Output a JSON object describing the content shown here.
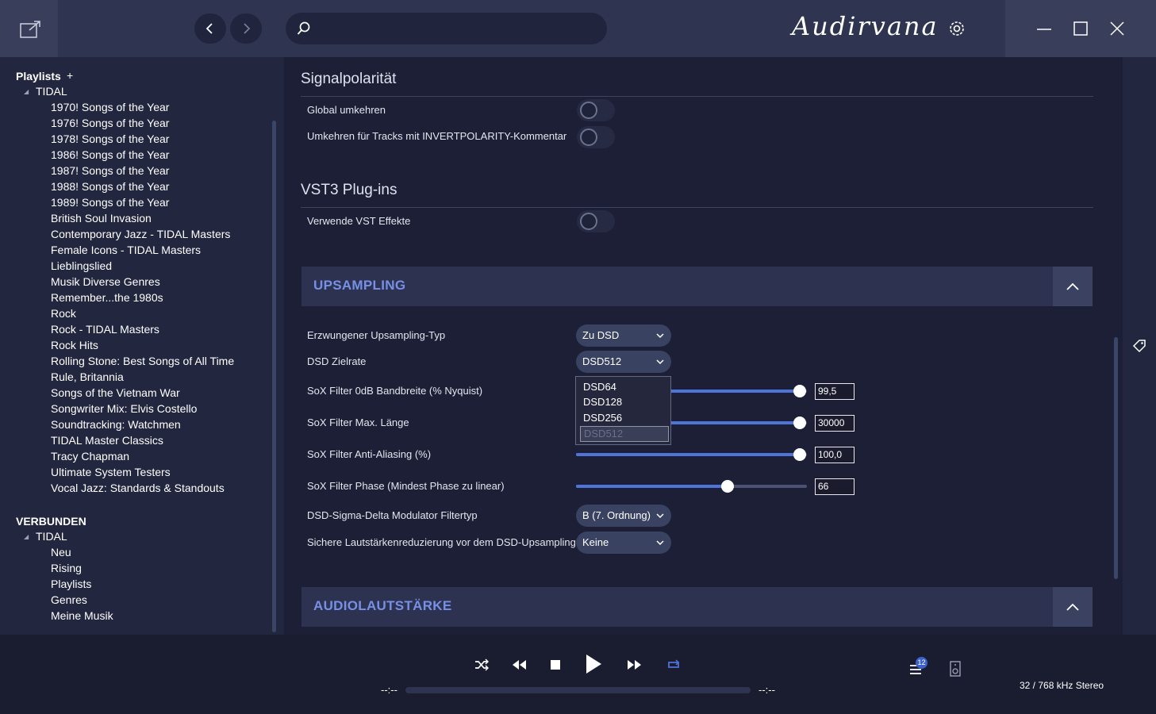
{
  "header": {
    "logo": "Audirvana",
    "search": {
      "placeholder": ""
    }
  },
  "sidebar": {
    "playlists_heading": "Playlists",
    "add_label": "+",
    "tidal_label": "TIDAL",
    "playlists": [
      "1970! Songs of the Year",
      "1976! Songs of the Year",
      "1978! Songs of the Year",
      "1986! Songs of the Year",
      "1987! Songs of the Year",
      "1988! Songs of the Year",
      "1989! Songs of the Year",
      "British Soul Invasion",
      "Contemporary Jazz - TIDAL Masters",
      "Female Icons - TIDAL Masters",
      "Lieblingslied",
      "Musik Diverse Genres",
      "Remember...the 1980s",
      "Rock",
      "Rock - TIDAL Masters",
      "Rock Hits",
      "Rolling Stone: Best Songs of All Time",
      "Rule, Britannia",
      "Songs of the Vietnam War",
      "Songwriter Mix: Elvis Costello",
      "Soundtracking: Watchmen",
      "TIDAL Master Classics",
      "Tracy Chapman",
      "Ultimate System Testers",
      "Vocal Jazz: Standards & Standouts"
    ],
    "connected_heading": "VERBUNDEN",
    "connected_tidal_label": "TIDAL",
    "connected_items": [
      "Neu",
      "Rising",
      "Playlists",
      "Genres",
      "Meine Musik"
    ]
  },
  "signal": {
    "title": "Signalpolarität",
    "global_invert": {
      "label": "Global umkehren",
      "on": false
    },
    "invert_tracks": {
      "label": "Umkehren für Tracks mit INVERTPOLARITY-Kommentar",
      "on": false
    }
  },
  "vst": {
    "title": "VST3 Plug-ins",
    "use_vst": {
      "label": "Verwende VST Effekte",
      "on": false
    }
  },
  "upsampling": {
    "title": "UPSAMPLING",
    "type": {
      "label": "Erzwungener Upsampling-Typ",
      "value": "Zu DSD"
    },
    "dsd_rate": {
      "label": "DSD Zielrate",
      "value": "DSD512",
      "options": [
        "DSD64",
        "DSD128",
        "DSD256"
      ],
      "selected_option": "DSD512"
    },
    "bandwidth": {
      "label": "SoX Filter 0dB Bandbreite (% Nyquist)",
      "value": "99,5",
      "fraction": 0.97
    },
    "max_length": {
      "label": "SoX Filter Max. Länge",
      "value": "30000",
      "fraction": 0.97
    },
    "anti_alias": {
      "label": "SoX Filter Anti-Aliasing (%)",
      "value": "100,0",
      "fraction": 0.97
    },
    "phase": {
      "label": "SoX Filter Phase (Mindest Phase zu linear)",
      "value": "66",
      "fraction": 0.655
    },
    "modulator": {
      "label": "DSD-Sigma-Delta Modulator Filtertyp",
      "value": "B (7. Ordnung)"
    },
    "volume_reduction": {
      "label": "Sichere Lautstärkenreduzierung vor dem DSD-Upsampling",
      "value": "Keine"
    }
  },
  "volume_section": {
    "title": "AUDIOLAUTSTÄRKE"
  },
  "player": {
    "elapsed": "--:--",
    "remaining": "--:--",
    "queue_count": "12",
    "format": "32 / 768 kHz Stereo",
    "progress": 0
  },
  "colors": {
    "accent": "#4f73d6",
    "section_title": "#7690e6"
  }
}
